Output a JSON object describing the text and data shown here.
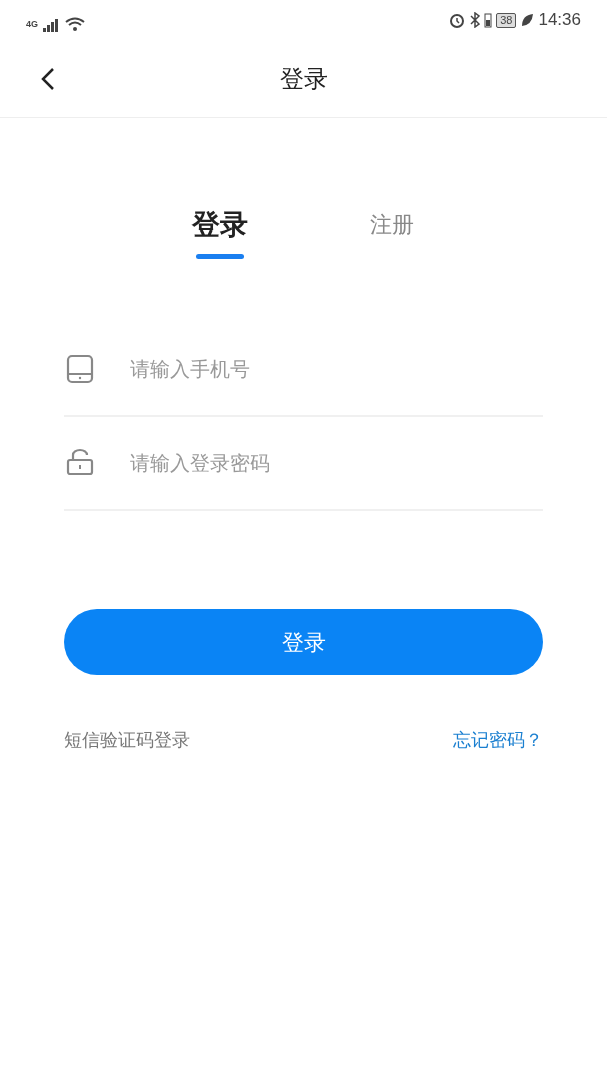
{
  "status_bar": {
    "network": "4G",
    "battery": "38",
    "time": "14:36"
  },
  "header": {
    "title": "登录"
  },
  "tabs": [
    {
      "label": "登录",
      "selected": true
    },
    {
      "label": "注册",
      "selected": false
    }
  ],
  "fields": [
    {
      "kind": "phone",
      "placeholder": "请输入手机号"
    },
    {
      "kind": "password",
      "placeholder": "请输入登录密码"
    }
  ],
  "submit": "登录",
  "links": {
    "left": "短信验证码登录",
    "right": "忘记密码？"
  }
}
